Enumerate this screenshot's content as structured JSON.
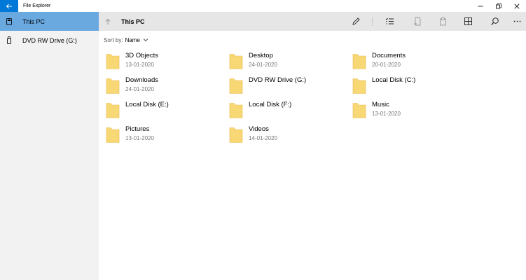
{
  "window": {
    "title": "File Explorer"
  },
  "sidebar": {
    "items": [
      {
        "label": "This PC",
        "icon": "pc-icon",
        "active": true
      },
      {
        "label": "DVD RW Drive (G:)",
        "icon": "usb-drive-icon",
        "active": false
      }
    ]
  },
  "toolbar": {
    "path": "This PC",
    "tools": [
      "rename-icon",
      "select-icon",
      "new-icon",
      "paste-icon",
      "view-icon",
      "search-icon",
      "more-icon"
    ]
  },
  "sort": {
    "label": "Sort by:",
    "value": "Name"
  },
  "items": [
    {
      "name": "3D Objects",
      "date": "13-01-2020"
    },
    {
      "name": "Desktop",
      "date": "24-01-2020"
    },
    {
      "name": "Documents",
      "date": "20-01-2020"
    },
    {
      "name": "Downloads",
      "date": "24-01-2020"
    },
    {
      "name": "DVD RW Drive (G:)",
      "date": ""
    },
    {
      "name": "Local Disk (C:)",
      "date": ""
    },
    {
      "name": "Local Disk (E:)",
      "date": ""
    },
    {
      "name": "Local Disk (F:)",
      "date": ""
    },
    {
      "name": "Music",
      "date": "13-01-2020"
    },
    {
      "name": "Pictures",
      "date": "13-01-2020"
    },
    {
      "name": "Videos",
      "date": "14-01-2020"
    }
  ],
  "colors": {
    "accent": "#0078d7",
    "sidebar_active": "#6aa8e0",
    "folder": "#f8d775"
  }
}
